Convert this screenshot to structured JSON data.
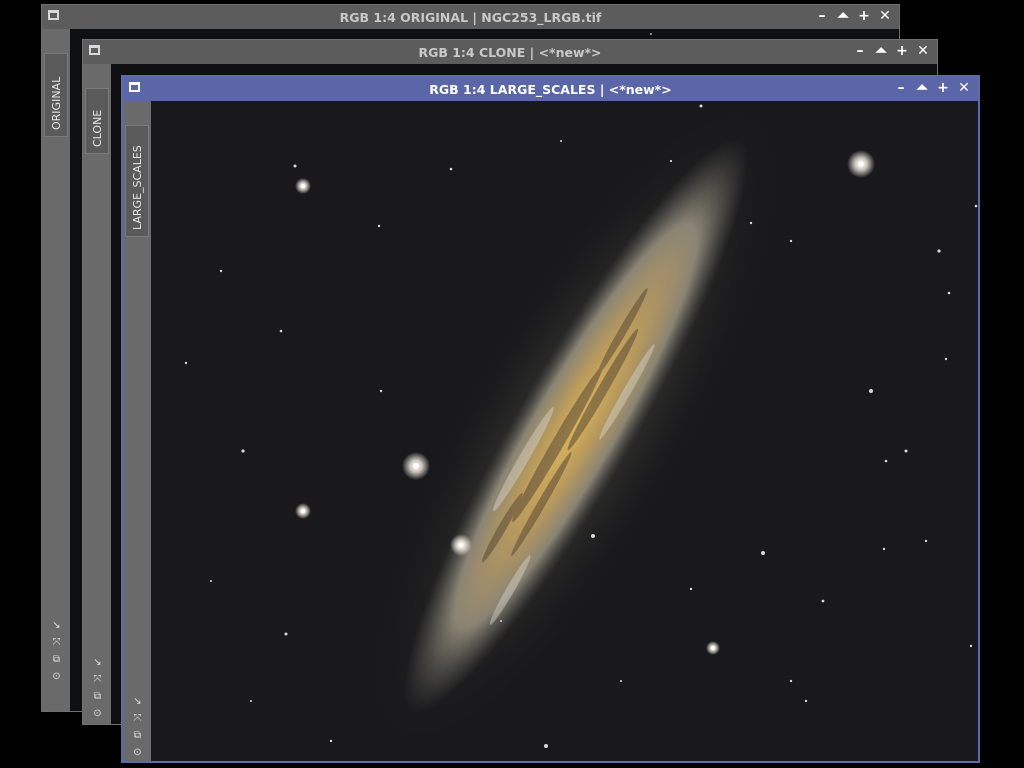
{
  "windows": {
    "original": {
      "title": "RGB 1:4 ORIGINAL | NGC253_LRGB.tif",
      "side_tab": "ORIGINAL"
    },
    "clone": {
      "title": "RGB 1:4 CLONE | <*new*>",
      "side_tab": "CLONE"
    },
    "large_scales": {
      "title": "RGB 1:4 LARGE_SCALES | <*new*>",
      "side_tab": "LARGE_SCALES"
    }
  },
  "window_controls": {
    "minimize": "–",
    "shade": "⏶",
    "maximize": "+",
    "close": "✕"
  },
  "side_tools": [
    "↘",
    "⤧",
    "⧉",
    "⊙"
  ],
  "colors": {
    "active_titlebar": "#5b66a8",
    "inactive_titlebar": "#5c5c5c",
    "image_background": "#161718",
    "galaxy_core": "#d8b25a"
  }
}
